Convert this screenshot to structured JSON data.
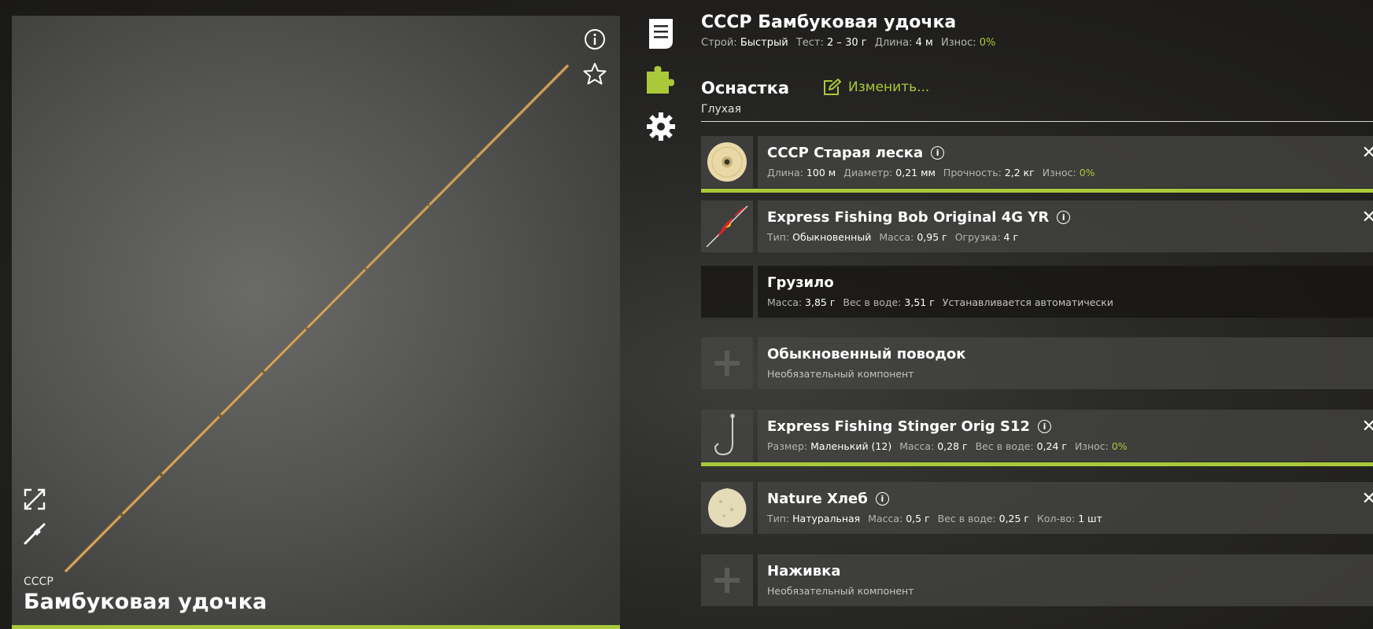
{
  "preview": {
    "brand": "СССР",
    "name": "Бамбуковая удочка"
  },
  "rod": {
    "title": "СССР Бамбуковая удочка",
    "build_label": "Строй:",
    "build_value": "Быстрый",
    "test_label": "Тест:",
    "test_value": "2 – 30 г",
    "length_label": "Длина:",
    "length_value": "4 м",
    "wear_label": "Износ:",
    "wear_value": "0%"
  },
  "rig": {
    "title": "Оснастка",
    "subtitle": "Глухая",
    "change_label": "Изменить..."
  },
  "items": [
    {
      "name": "СССР Старая леска",
      "props": [
        {
          "label": "Длина:",
          "value": "100 м"
        },
        {
          "label": "Диаметр:",
          "value": "0,21 мм"
        },
        {
          "label": "Прочность:",
          "value": "2,2 кг"
        },
        {
          "label": "Износ:",
          "value": "0%"
        }
      ]
    },
    {
      "name": "Express Fishing Bob Original 4G YR",
      "props": [
        {
          "label": "Тип:",
          "value": "Обыкновенный"
        },
        {
          "label": "Масса:",
          "value": "0,95 г"
        },
        {
          "label": "Огрузка:",
          "value": "4 г"
        }
      ]
    },
    {
      "name": "Грузило",
      "props": [
        {
          "label": "Масса:",
          "value": "3,85 г"
        },
        {
          "label": "Вес в воде:",
          "value": "3,51 г"
        }
      ],
      "note": "Устанавливается автоматически"
    },
    {
      "name": "Обыкновенный поводок",
      "note": "Необязательный компонент"
    },
    {
      "name": "Express Fishing Stinger Orig S12",
      "props": [
        {
          "label": "Размер:",
          "value": "Маленький (12)"
        },
        {
          "label": "Масса:",
          "value": "0,28 г"
        },
        {
          "label": "Вес в воде:",
          "value": "0,24 г"
        },
        {
          "label": "Износ:",
          "value": "0%"
        }
      ]
    },
    {
      "name": "Nature Хлеб",
      "props": [
        {
          "label": "Тип:",
          "value": "Натуральная"
        },
        {
          "label": "Масса:",
          "value": "0,5 г"
        },
        {
          "label": "Вес в воде:",
          "value": "0,25 г"
        },
        {
          "label": "Кол-во:",
          "value": "1 шт"
        }
      ]
    },
    {
      "name": "Наживка",
      "note": "Необязательный компонент"
    }
  ],
  "ui": {
    "info_glyph": "i",
    "close_glyph": "✕"
  },
  "colors": {
    "accent": "#a9c93b"
  }
}
